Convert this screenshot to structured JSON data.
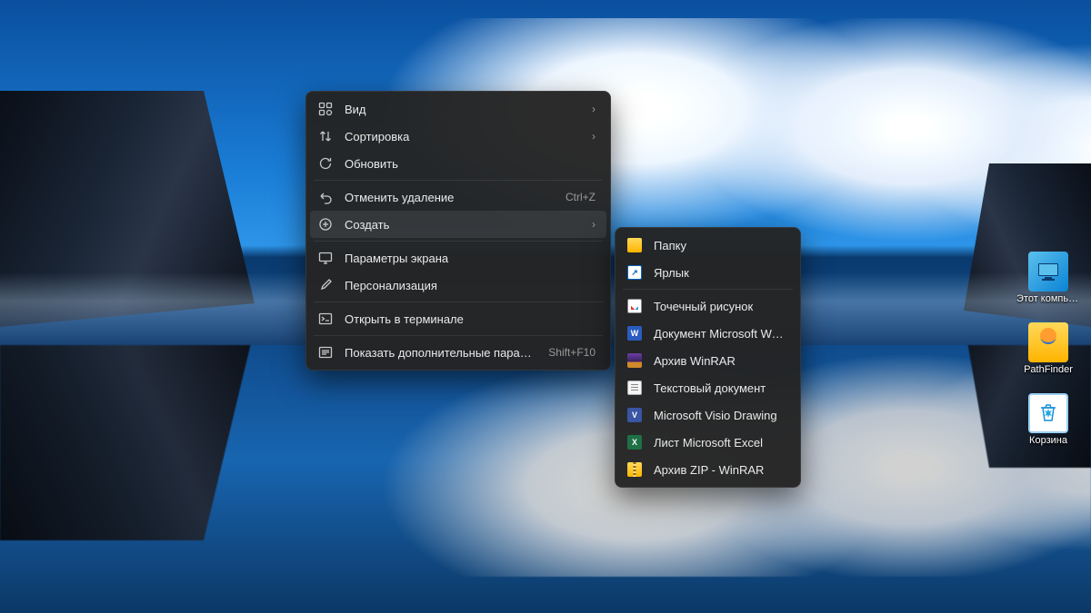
{
  "desktop_icons": [
    {
      "label": "Этот компью..."
    },
    {
      "label": "PathFinder"
    },
    {
      "label": "Корзина"
    }
  ],
  "menu": {
    "items": [
      {
        "icon": "grid",
        "label": "Вид",
        "tail": "›"
      },
      {
        "icon": "sort",
        "label": "Сортировка",
        "tail": "›"
      },
      {
        "icon": "refresh",
        "label": "Обновить",
        "tail": ""
      },
      {
        "sep": true
      },
      {
        "icon": "undo",
        "label": "Отменить удаление",
        "tail": "Ctrl+Z"
      },
      {
        "icon": "new",
        "label": "Создать",
        "tail": "›",
        "hover": true
      },
      {
        "sep": true
      },
      {
        "icon": "display",
        "label": "Параметры экрана",
        "tail": ""
      },
      {
        "icon": "brush",
        "label": "Персонализация",
        "tail": ""
      },
      {
        "sep": true
      },
      {
        "icon": "terminal",
        "label": "Открыть в терминале",
        "tail": ""
      },
      {
        "sep": true
      },
      {
        "icon": "more",
        "label": "Показать дополнительные параметры",
        "tail": "Shift+F10"
      }
    ]
  },
  "submenu": {
    "items": [
      {
        "ft": "folder",
        "label": "Папку"
      },
      {
        "ft": "link",
        "label": "Ярлык"
      },
      {
        "sep": true
      },
      {
        "ft": "bmp",
        "label": "Точечный рисунок"
      },
      {
        "ft": "word",
        "label": "Документ Microsoft Word"
      },
      {
        "ft": "rar",
        "label": "Архив WinRAR"
      },
      {
        "ft": "txt",
        "label": "Текстовый документ"
      },
      {
        "ft": "visio",
        "label": "Microsoft Visio Drawing"
      },
      {
        "ft": "excel",
        "label": "Лист Microsoft Excel"
      },
      {
        "ft": "zip",
        "label": "Архив ZIP - WinRAR"
      }
    ]
  }
}
